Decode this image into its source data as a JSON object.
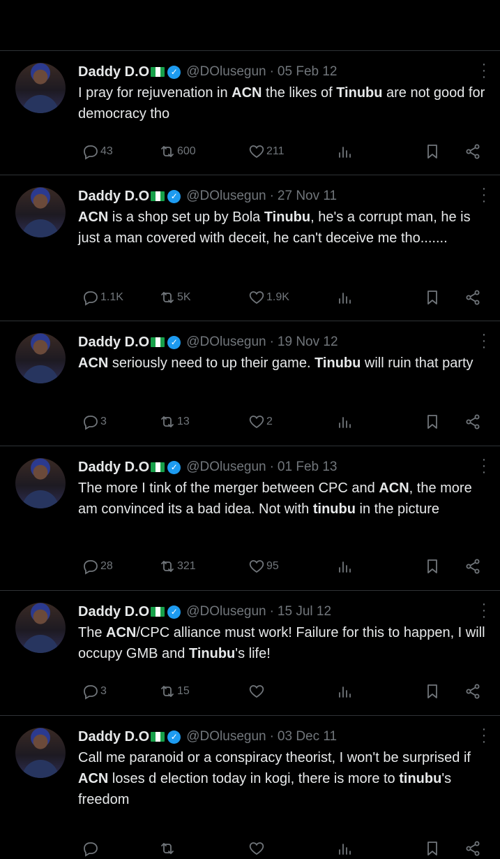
{
  "tweets": [
    {
      "name": "Daddy D.O",
      "handle": "@DOlusegun",
      "separator": "·",
      "date": "05 Feb 12",
      "segments": [
        {
          "t": "I pray for rejuvenation in ",
          "b": false
        },
        {
          "t": "ACN",
          "b": true
        },
        {
          "t": " the likes of ",
          "b": false
        },
        {
          "t": "Tinubu",
          "b": true
        },
        {
          "t": " are not good for democracy tho",
          "b": false
        }
      ],
      "replies": "43",
      "retweets": "600",
      "likes": "211"
    },
    {
      "name": "Daddy D.O",
      "handle": "@DOlusegun",
      "separator": "·",
      "date": "27 Nov 11",
      "segments": [
        {
          "t": "ACN",
          "b": true
        },
        {
          "t": " is a shop set up by Bola ",
          "b": false
        },
        {
          "t": "Tinubu",
          "b": true
        },
        {
          "t": ", he's a corrupt man, he is just a man covered with deceit, he can't deceive me tho.......",
          "b": false
        }
      ],
      "replies": "1.1K",
      "retweets": "5K",
      "likes": "1.9K"
    },
    {
      "name": "Daddy D.O",
      "handle": "@DOlusegun",
      "separator": "·",
      "date": "19 Nov 12",
      "segments": [
        {
          "t": "ACN",
          "b": true
        },
        {
          "t": " seriously need to up their game. ",
          "b": false
        },
        {
          "t": "Tinubu",
          "b": true
        },
        {
          "t": " will ruin that party",
          "b": false
        }
      ],
      "replies": "3",
      "retweets": "13",
      "likes": "2"
    },
    {
      "name": "Daddy D.O",
      "handle": "@DOlusegun",
      "separator": "·",
      "date": "01 Feb 13",
      "segments": [
        {
          "t": "The more I tink of the merger between CPC and ",
          "b": false
        },
        {
          "t": "ACN",
          "b": true
        },
        {
          "t": ", the more am convinced its a bad idea. Not with ",
          "b": false
        },
        {
          "t": "tinubu",
          "b": true
        },
        {
          "t": " in the picture",
          "b": false
        }
      ],
      "replies": "28",
      "retweets": "321",
      "likes": "95"
    },
    {
      "name": "Daddy D.O",
      "handle": "@DOlusegun",
      "separator": "·",
      "date": "15 Jul 12",
      "segments": [
        {
          "t": "The ",
          "b": false
        },
        {
          "t": "ACN",
          "b": true
        },
        {
          "t": "/CPC alliance must work! Failure for this to happen, I will occupy GMB and ",
          "b": false
        },
        {
          "t": "Tinubu",
          "b": true
        },
        {
          "t": "'s life!",
          "b": false
        }
      ],
      "replies": "3",
      "retweets": "15",
      "likes": ""
    },
    {
      "name": "Daddy D.O",
      "handle": "@DOlusegun",
      "separator": "·",
      "date": "03 Dec 11",
      "segments": [
        {
          "t": "Call me paranoid or a conspiracy theorist, I won't be surprised if ",
          "b": false
        },
        {
          "t": "ACN",
          "b": true
        },
        {
          "t": " loses d election today in kogi, there is more to ",
          "b": false
        },
        {
          "t": "tinubu",
          "b": true
        },
        {
          "t": "'s freedom",
          "b": false
        }
      ],
      "replies": "",
      "retweets": "",
      "likes": ""
    }
  ],
  "icons": {
    "reply": "reply-icon",
    "retweet": "retweet-icon",
    "like": "like-icon",
    "views": "views-icon",
    "bookmark": "bookmark-icon",
    "share": "share-icon",
    "more": "more-vertical-icon",
    "verified": "verified-badge-icon",
    "flag": "nigeria-flag-icon"
  },
  "colors": {
    "background": "#000000",
    "text": "#e7e9ea",
    "muted": "#71767b",
    "divider": "#2f3336",
    "verified": "#1d9bf0"
  }
}
